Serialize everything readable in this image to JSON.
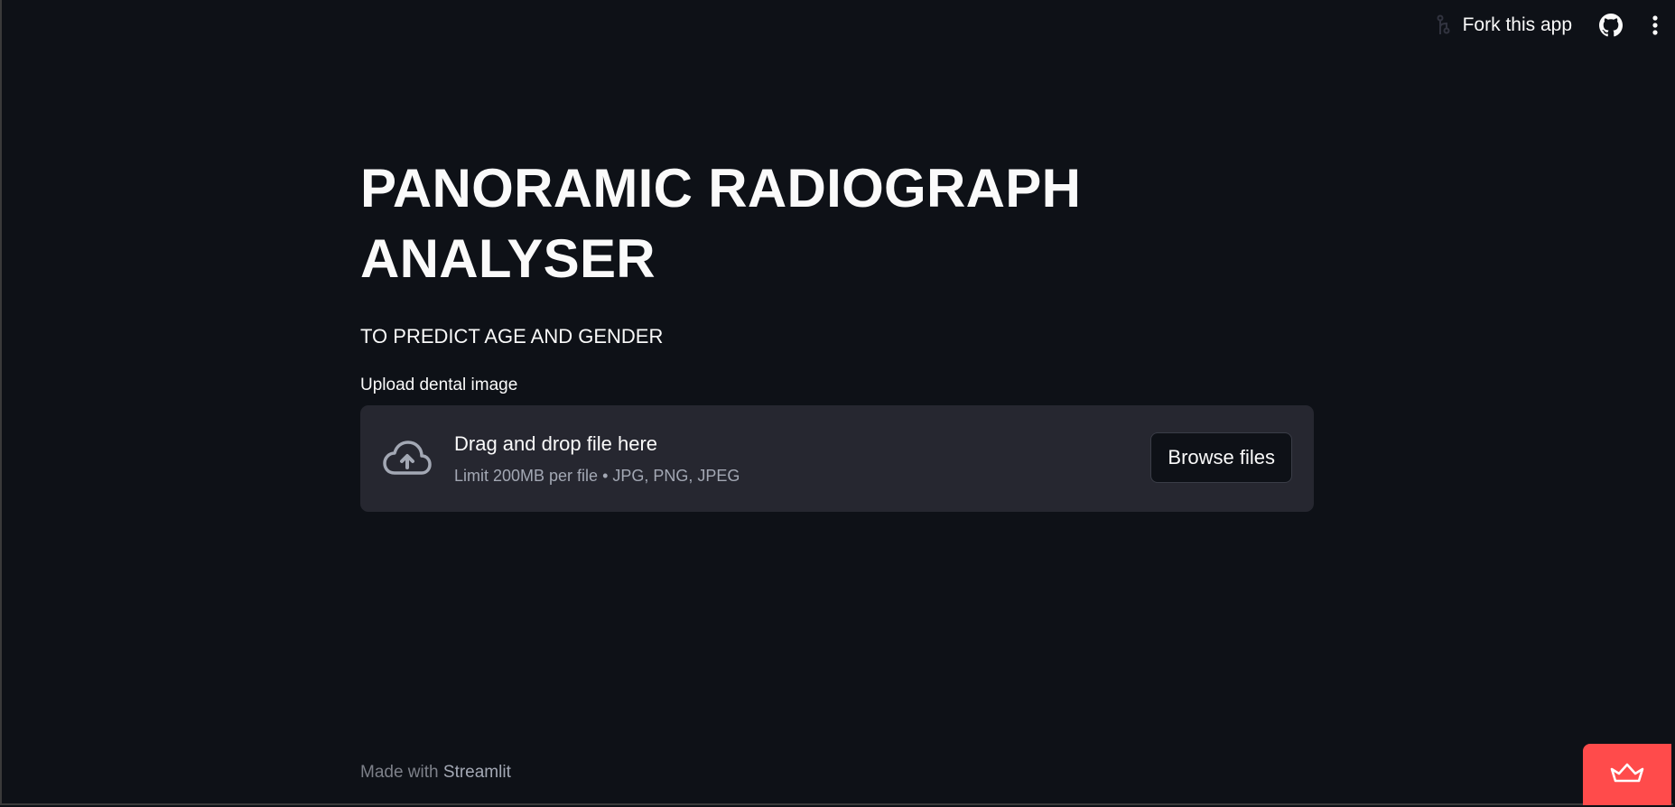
{
  "toolbar": {
    "fork_label": "Fork this app",
    "icons": [
      "fork-icon",
      "github-icon",
      "more-vertical-icon"
    ]
  },
  "main": {
    "title_line1": "PANORAMIC RADIOGRAPH",
    "title_line2": "ANALYSER",
    "subtitle": "TO PREDICT AGE AND GENDER",
    "uploader": {
      "label": "Upload dental image",
      "dropzone_title": "Drag and drop file here",
      "dropzone_limit": "Limit 200MB per file • JPG, PNG, JPEG",
      "browse_label": "Browse files",
      "icon": "cloud-upload-icon"
    }
  },
  "footer": {
    "prefix": "Made with",
    "brand": "Streamlit"
  },
  "colors": {
    "background": "#0e1117",
    "dropzone": "#262730",
    "accent": "#ff4b4b",
    "text": "#fafafa",
    "muted": "#a3a8b4"
  }
}
